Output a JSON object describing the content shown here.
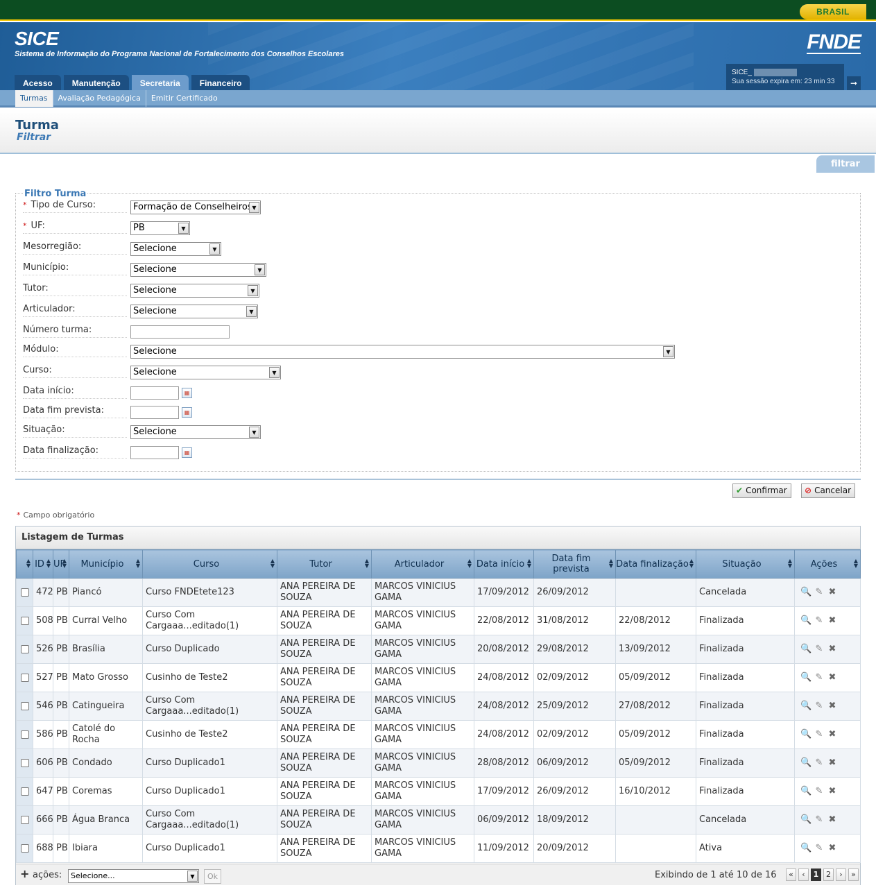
{
  "header": {
    "brasil_label": "BRASIL",
    "app_name": "SICE",
    "app_subtitle": "Sistema de Informação do Programa Nacional de Fortalecimento dos Conselhos Escolares",
    "logo_text": "FNDE",
    "session_user": "SICE_",
    "session_expiry": "Sua sessão expira em: 23 min 33"
  },
  "main_tabs": [
    {
      "label": "Acesso",
      "active": false
    },
    {
      "label": "Manutenção",
      "active": false
    },
    {
      "label": "Secretaria",
      "active": true
    },
    {
      "label": "Financeiro",
      "active": false
    }
  ],
  "sub_nav": [
    {
      "label": "Turmas",
      "active": true
    },
    {
      "label": "Avaliação Pedagógica",
      "active": false
    },
    {
      "label": "Emitir Certificado",
      "active": false
    }
  ],
  "page": {
    "title": "Turma",
    "subtitle": "Filtrar",
    "filter_tab": "filtrar"
  },
  "filter": {
    "legend": "Filtro Turma",
    "tipo_curso": {
      "label": "Tipo de Curso:",
      "value": "Formação de Conselheiros"
    },
    "uf": {
      "label": "UF:",
      "value": "PB"
    },
    "mesorregiao": {
      "label": "Mesorregião:",
      "value": "Selecione"
    },
    "municipio": {
      "label": "Município:",
      "value": "Selecione"
    },
    "tutor": {
      "label": "Tutor:",
      "value": "Selecione"
    },
    "articulador": {
      "label": "Articulador:",
      "value": "Selecione"
    },
    "numero_turma": {
      "label": "Número turma:",
      "value": ""
    },
    "modulo": {
      "label": "Módulo:",
      "value": "Selecione"
    },
    "curso": {
      "label": "Curso:",
      "value": "Selecione"
    },
    "data_inicio": {
      "label": "Data início:",
      "value": ""
    },
    "data_fim_prevista": {
      "label": "Data fim prevista:",
      "value": ""
    },
    "situacao": {
      "label": "Situação:",
      "value": "Selecione"
    },
    "data_finalizacao": {
      "label": "Data finalização:",
      "value": ""
    }
  },
  "buttons": {
    "confirm": "Confirmar",
    "cancel": "Cancelar"
  },
  "required_note": "Campo obrigatório",
  "listing": {
    "title": "Listagem de Turmas",
    "columns": [
      "ID",
      "UF",
      "Município",
      "Curso",
      "Tutor",
      "Articulador",
      "Data início",
      "Data fim prevista",
      "Data finalização",
      "Situação",
      "Ações"
    ],
    "rows": [
      {
        "id": "472",
        "uf": "PB",
        "municipio": "Piancó",
        "curso": "Curso FNDEtete123",
        "tutor": "ANA PEREIRA DE SOUZA",
        "articulador": "MARCOS VINICIUS GAMA",
        "inicio": "17/09/2012",
        "fim": "26/09/2012",
        "finalizacao": "",
        "situacao": "Cancelada"
      },
      {
        "id": "508",
        "uf": "PB",
        "municipio": "Curral Velho",
        "curso": "Curso Com Cargaaa...editado(1)",
        "tutor": "ANA PEREIRA DE SOUZA",
        "articulador": "MARCOS VINICIUS GAMA",
        "inicio": "22/08/2012",
        "fim": "31/08/2012",
        "finalizacao": "22/08/2012",
        "situacao": "Finalizada"
      },
      {
        "id": "526",
        "uf": "PB",
        "municipio": "Brasília",
        "curso": "Curso Duplicado",
        "tutor": "ANA PEREIRA DE SOUZA",
        "articulador": "MARCOS VINICIUS GAMA",
        "inicio": "20/08/2012",
        "fim": "29/08/2012",
        "finalizacao": "13/09/2012",
        "situacao": "Finalizada"
      },
      {
        "id": "527",
        "uf": "PB",
        "municipio": "Mato Grosso",
        "curso": "Cusinho de Teste2",
        "tutor": "ANA PEREIRA DE SOUZA",
        "articulador": "MARCOS VINICIUS GAMA",
        "inicio": "24/08/2012",
        "fim": "02/09/2012",
        "finalizacao": "05/09/2012",
        "situacao": "Finalizada"
      },
      {
        "id": "546",
        "uf": "PB",
        "municipio": "Catingueira",
        "curso": "Curso Com Cargaaa...editado(1)",
        "tutor": "ANA PEREIRA DE SOUZA",
        "articulador": "MARCOS VINICIUS GAMA",
        "inicio": "24/08/2012",
        "fim": "25/09/2012",
        "finalizacao": "27/08/2012",
        "situacao": "Finalizada"
      },
      {
        "id": "586",
        "uf": "PB",
        "municipio": "Catolé do Rocha",
        "curso": "Cusinho de Teste2",
        "tutor": "ANA PEREIRA DE SOUZA",
        "articulador": "MARCOS VINICIUS GAMA",
        "inicio": "24/08/2012",
        "fim": "02/09/2012",
        "finalizacao": "05/09/2012",
        "situacao": "Finalizada"
      },
      {
        "id": "606",
        "uf": "PB",
        "municipio": "Condado",
        "curso": "Curso Duplicado1",
        "tutor": "ANA PEREIRA DE SOUZA",
        "articulador": "MARCOS VINICIUS GAMA",
        "inicio": "28/08/2012",
        "fim": "06/09/2012",
        "finalizacao": "05/09/2012",
        "situacao": "Finalizada"
      },
      {
        "id": "647",
        "uf": "PB",
        "municipio": "Coremas",
        "curso": "Curso Duplicado1",
        "tutor": "ANA PEREIRA DE SOUZA",
        "articulador": "MARCOS VINICIUS GAMA",
        "inicio": "17/09/2012",
        "fim": "26/09/2012",
        "finalizacao": "16/10/2012",
        "situacao": "Finalizada"
      },
      {
        "id": "666",
        "uf": "PB",
        "municipio": "Água Branca",
        "curso": "Curso Com Cargaaa...editado(1)",
        "tutor": "ANA PEREIRA DE SOUZA",
        "articulador": "MARCOS VINICIUS GAMA",
        "inicio": "06/09/2012",
        "fim": "18/09/2012",
        "finalizacao": "",
        "situacao": "Cancelada"
      },
      {
        "id": "688",
        "uf": "PB",
        "municipio": "Ibiara",
        "curso": "Curso Duplicado1",
        "tutor": "ANA PEREIRA DE SOUZA",
        "articulador": "MARCOS VINICIUS GAMA",
        "inicio": "11/09/2012",
        "fim": "20/09/2012",
        "finalizacao": "",
        "situacao": "Ativa"
      }
    ],
    "footer": {
      "acoes_label": "ações:",
      "acoes_select": "Selecione...",
      "ok_label": "Ok",
      "showing": "Exibindo de 1 até 10 de 16",
      "pages": [
        "1",
        "2"
      ],
      "current_page": "1"
    }
  },
  "icons": {
    "plus": "plus-icon",
    "view": "view-icon",
    "edit": "edit-icon",
    "delete": "delete-icon",
    "calendar": "calendar-icon",
    "confirm": "check-icon",
    "cancel": "cancel-icon",
    "logout": "logout-icon"
  },
  "colors": {
    "brand_green": "#0c4d21",
    "header_blue": "#2a6aa8",
    "tab_active": "#6d9ccc",
    "grid_header": "#8fb0d0"
  }
}
